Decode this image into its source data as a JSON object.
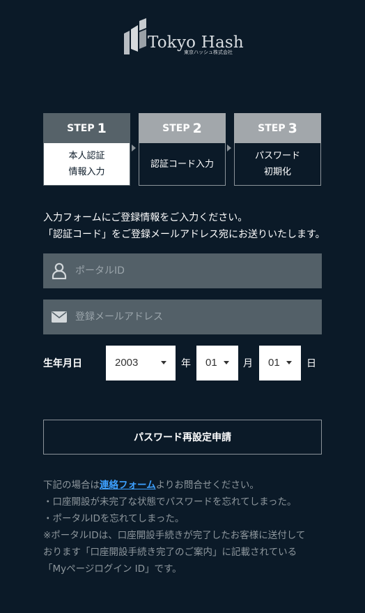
{
  "brand": {
    "name": "Tokyo Hash",
    "sub": "東京ハッシュ株式会社"
  },
  "steps": [
    {
      "word": "STEP",
      "num": "1",
      "line1": "本人認証",
      "line2": "情報入力",
      "active": true
    },
    {
      "word": "STEP",
      "num": "2",
      "line1": "認証コード入力",
      "line2": "",
      "active": false
    },
    {
      "word": "STEP",
      "num": "3",
      "line1": "パスワード",
      "line2": "初期化",
      "active": false
    }
  ],
  "intro": {
    "line1": "入力フォームにご登録情報をご入力ください。",
    "line2": "「認証コード」をご登録メールアドレス宛にお送りいたします。"
  },
  "form": {
    "portal_placeholder": "ポータルID",
    "email_placeholder": "登録メールアドレス",
    "birth_label": "生年月日",
    "year_value": "2003",
    "year_unit": "年",
    "month_value": "01",
    "month_unit": "月",
    "day_value": "01",
    "day_unit": "日",
    "submit_label": "パスワード再設定申請"
  },
  "notes": {
    "line1_before": "下記の場合は",
    "line1_link": "連絡フォーム",
    "line1_after": "よりお問合せください。",
    "line2": "・口座開設が未完了な状態でパスワードを忘れてしまった。",
    "line3": "・ポータルIDを忘れてしまった。",
    "line4": "※ポータルIDは、口座開設手続きが完了したお客様に送付して",
    "line5": "おります「口座開設手続き完了のご案内」に記載されている",
    "line6": "「Myページログイン ID」です。"
  },
  "colors": {
    "background": "#0b1a28",
    "field_bg": "#536068",
    "step_active_head": "#566269",
    "step_inactive_head": "#a2a7ab",
    "link": "#3da0ff"
  },
  "icons": {
    "portal": "user-icon",
    "email": "envelope-icon",
    "select": "caret-down-icon"
  }
}
